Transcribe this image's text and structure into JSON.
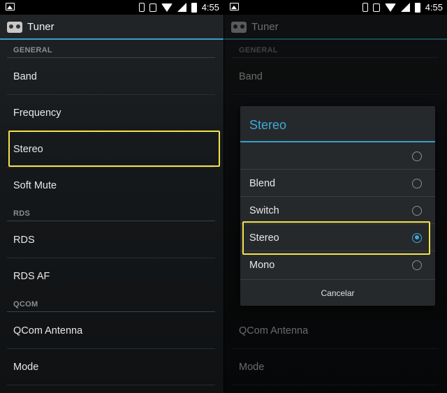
{
  "status_bar": {
    "time": "4:55"
  },
  "app": {
    "title": "Tuner"
  },
  "settings": {
    "categories": {
      "general": "GENERAL",
      "rds": "RDS",
      "qcom": "QCOM"
    },
    "items": {
      "band": "Band",
      "frequency": "Frequency",
      "stereo": "Stereo",
      "soft_mute": "Soft Mute",
      "rds": "RDS",
      "rds_af": "RDS AF",
      "qcom_antenna": "QCom Antenna",
      "mode": "Mode"
    }
  },
  "dialog": {
    "title": "Stereo",
    "options": [
      "",
      "Blend",
      "Switch",
      "Stereo",
      "Mono"
    ],
    "selected": "Stereo",
    "cancel_label": "Cancelar"
  },
  "colors": {
    "accent": "#3fa9d8",
    "highlight": "#f3e24a",
    "background": "#1a1d20"
  }
}
